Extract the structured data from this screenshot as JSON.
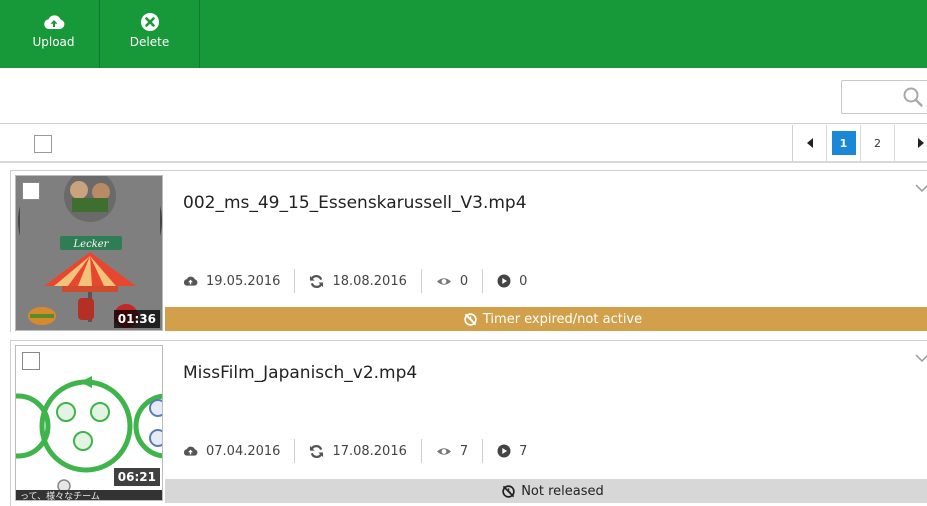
{
  "toolbar": {
    "upload_label": "Upload",
    "delete_label": "Delete"
  },
  "search": {
    "placeholder": ""
  },
  "pagination": {
    "pages": [
      "1",
      "2"
    ],
    "current": "1",
    "prev_icon": "caret-left-icon",
    "next_icon": "caret-right-icon"
  },
  "videos": [
    {
      "title": "002_ms_49_15_Essenskarussell_V3.mp4",
      "duration": "01:36",
      "thumb_text": "Lecker",
      "uploaded": "19.05.2016",
      "updated": "18.08.2016",
      "views": "0",
      "plays": "0",
      "status": "Timer expired/not active",
      "status_bg": "#d2a04a",
      "status_color": "#ffffff"
    },
    {
      "title": "MissFilm_Japanisch_v2.mp4",
      "duration": "06:21",
      "thumb_text": "って、様々なチーム",
      "uploaded": "07.04.2016",
      "updated": "17.08.2016",
      "views": "7",
      "plays": "7",
      "status": "Not released",
      "status_bg": "#d7d7d7",
      "status_color": "#222222"
    }
  ],
  "colors": {
    "accent": "#17993a",
    "pager_active": "#1a88d6"
  }
}
